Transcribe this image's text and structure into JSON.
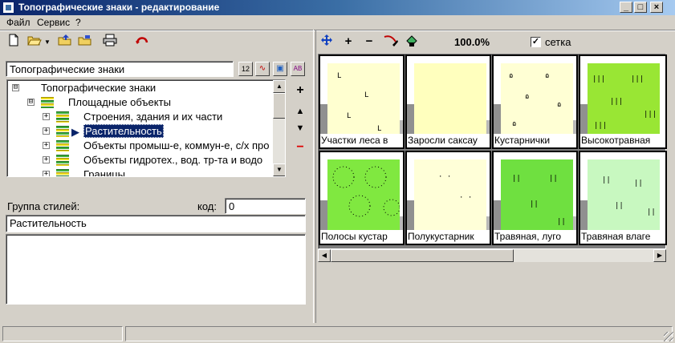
{
  "window": {
    "title": "Топографические знаки - редактирование",
    "controls": {
      "minimize": "_",
      "maximize": "□",
      "close": "×"
    }
  },
  "menu": [
    "Файл",
    "Сервис",
    "?"
  ],
  "left_toolbar": {
    "icons": [
      "new-file-icon",
      "open-folder-icon",
      "dropdown-arrow-icon",
      "folder-up-icon",
      "folder-export-icon",
      "print-icon",
      "undo-icon"
    ]
  },
  "library_field": {
    "value": "Топографические знаки",
    "buttons": [
      "12",
      "∿",
      "▣",
      "АВ"
    ]
  },
  "tree": {
    "items": [
      {
        "label": "Топографические знаки",
        "level": 0,
        "expander": "⊟"
      },
      {
        "label": "Площадные объекты",
        "level": 1,
        "expander": "⊟"
      },
      {
        "label": "Строения, здания и их части",
        "level": 2,
        "expander": "+"
      },
      {
        "label": "Растительность",
        "level": 2,
        "expander": "+",
        "selected": true
      },
      {
        "label": "Объекты промыш-е, коммун-е, с/х про",
        "level": 2,
        "expander": "+"
      },
      {
        "label": "Объекты гидротех., вод. тр-та и водо",
        "level": 2,
        "expander": "+"
      },
      {
        "label": "Границы",
        "level": 2,
        "expander": "+"
      }
    ]
  },
  "side_buttons": [
    "+",
    "▲",
    "▼",
    "−"
  ],
  "group": {
    "label": "Группа стилей:",
    "code_label": "код:",
    "code_value": "0",
    "name_value": "Растительность",
    "description_value": ""
  },
  "right_toolbar": {
    "icons": [
      "move-icon",
      "zoom-in-icon",
      "zoom-out-icon",
      "pick-color-icon",
      "fill-icon"
    ],
    "zoom_in": "+",
    "zoom_out": "−",
    "zoom": "100.0%",
    "grid_checkbox_label": "сетка",
    "grid_checked": true
  },
  "swatches": [
    {
      "caption": "Участки леса в",
      "color": "#ffffd0",
      "marks": "L"
    },
    {
      "caption": "Заросли саксау",
      "color": "#ffffbe",
      "marks": ""
    },
    {
      "caption": "Кустарнички",
      "color": "#ffffd4",
      "marks": "•"
    },
    {
      "caption": "Высокотравная",
      "color": "#99e634",
      "marks": "|||"
    },
    {
      "caption": "Полосы кустар",
      "color": "#80e840",
      "marks": "o"
    },
    {
      "caption": "Полукустарник",
      "color": "#ffffd8",
      "marks": "··"
    },
    {
      "caption": "Травяная, луго",
      "color": "#6fe040",
      "marks": "||"
    },
    {
      "caption": "Травяная влаге",
      "color": "#c8f8c0",
      "marks": "||"
    }
  ]
}
